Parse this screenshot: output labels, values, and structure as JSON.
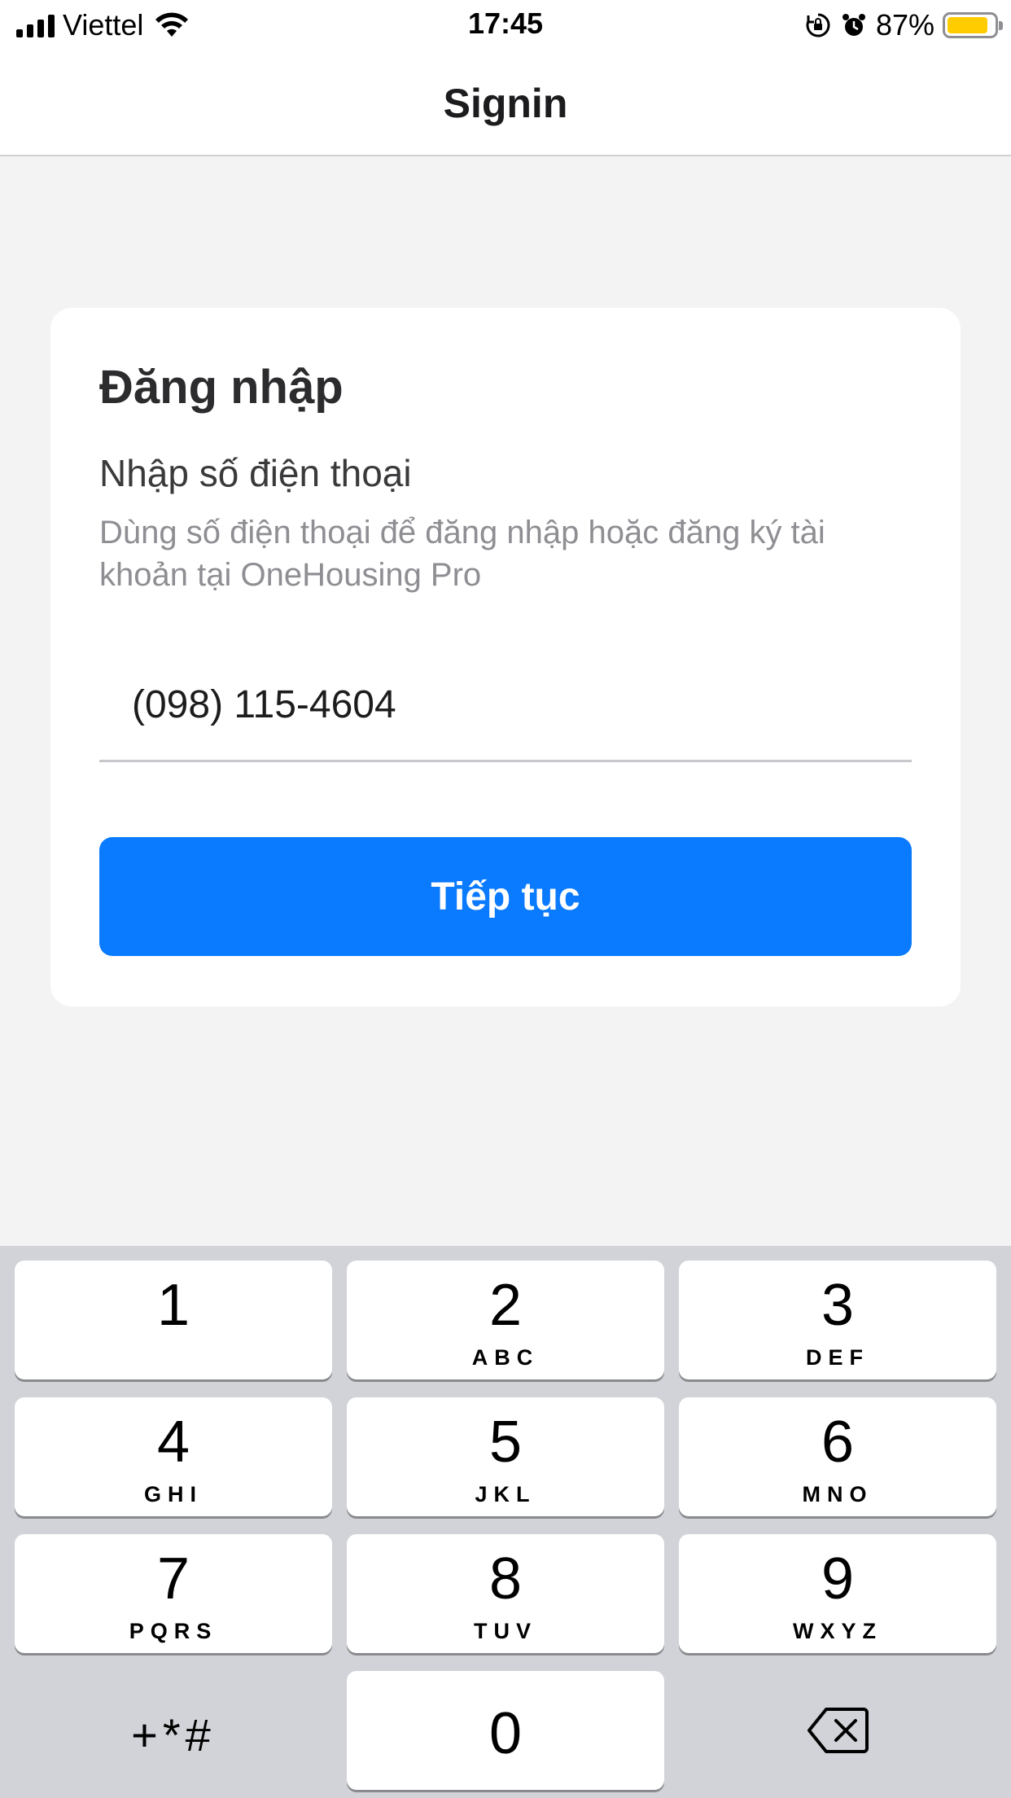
{
  "status_bar": {
    "carrier": "Viettel",
    "time": "17:45",
    "battery_percent": "87%",
    "battery_level": 0.87,
    "battery_color": "#ffcc00",
    "icons": [
      "signal-icon",
      "wifi-icon",
      "orientation-lock-icon",
      "alarm-icon",
      "battery-icon"
    ]
  },
  "nav": {
    "title": "Signin"
  },
  "login_card": {
    "heading": "Đăng nhập",
    "field_label": "Nhập số điện thoại",
    "field_help": "Dùng số điện thoại để đăng nhập hoặc đăng ký tài khoản tại OneHousing Pro",
    "phone_value": "(098) 115-4604",
    "continue_label": "Tiếp tục",
    "accent_color": "#0a7aff"
  },
  "keypad": {
    "keys": [
      {
        "digit": "1",
        "letters": ""
      },
      {
        "digit": "2",
        "letters": "ABC"
      },
      {
        "digit": "3",
        "letters": "DEF"
      },
      {
        "digit": "4",
        "letters": "GHI"
      },
      {
        "digit": "5",
        "letters": "JKL"
      },
      {
        "digit": "6",
        "letters": "MNO"
      },
      {
        "digit": "7",
        "letters": "PQRS"
      },
      {
        "digit": "8",
        "letters": "TUV"
      },
      {
        "digit": "9",
        "letters": "WXYZ"
      },
      {
        "digit": "0",
        "letters": ""
      }
    ],
    "symbols_label": "+*#",
    "delete_icon": "backspace-icon"
  }
}
